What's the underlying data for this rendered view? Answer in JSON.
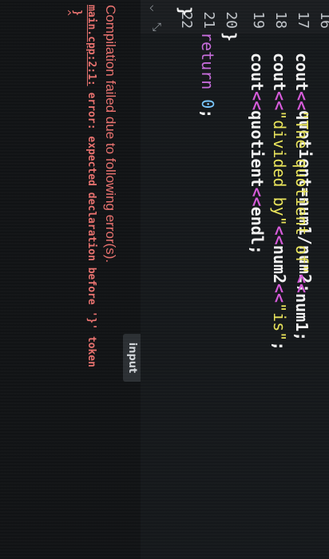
{
  "editor": {
    "line_numbers": [
      "16",
      "17",
      "18",
      "19",
      "20",
      "21",
      "22"
    ],
    "lines": {
      "l16": {
        "text": "quotient=num1/num2;"
      },
      "l17": {
        "cout": "cout",
        "op1": "<<",
        "str": "\"The quotient of\"",
        "op2": "<<",
        "var": "num1;"
      },
      "l18": {
        "cout": "cout",
        "op1": "<<",
        "str": "\"divided by\"",
        "op2": "<<",
        "var": "num2",
        "op3": "<<",
        "str2": "\"is\"",
        "end": ";"
      },
      "l19": {
        "cout": "cout",
        "op1": "<<",
        "var": "quotient",
        "op2": "<<",
        "end": "endl;"
      },
      "l20": {
        "brace": "}"
      },
      "l21": {
        "kw": "return",
        "num": "0",
        "end": ";"
      },
      "l22": {
        "brace": "}"
      }
    }
  },
  "output": {
    "tab_label": "input",
    "compile_message": "Compilation failed due to following error(s).",
    "error": {
      "file": "main.cpp:2:1:",
      "message": " error: expected declaration before '}' token",
      "source_line": "}",
      "caret": "^"
    }
  },
  "colors": {
    "error": "#e8716e",
    "string": "#e8e35a",
    "operator": "#d45ad8",
    "keyword": "#c56bd9",
    "number": "#79c7ff"
  }
}
